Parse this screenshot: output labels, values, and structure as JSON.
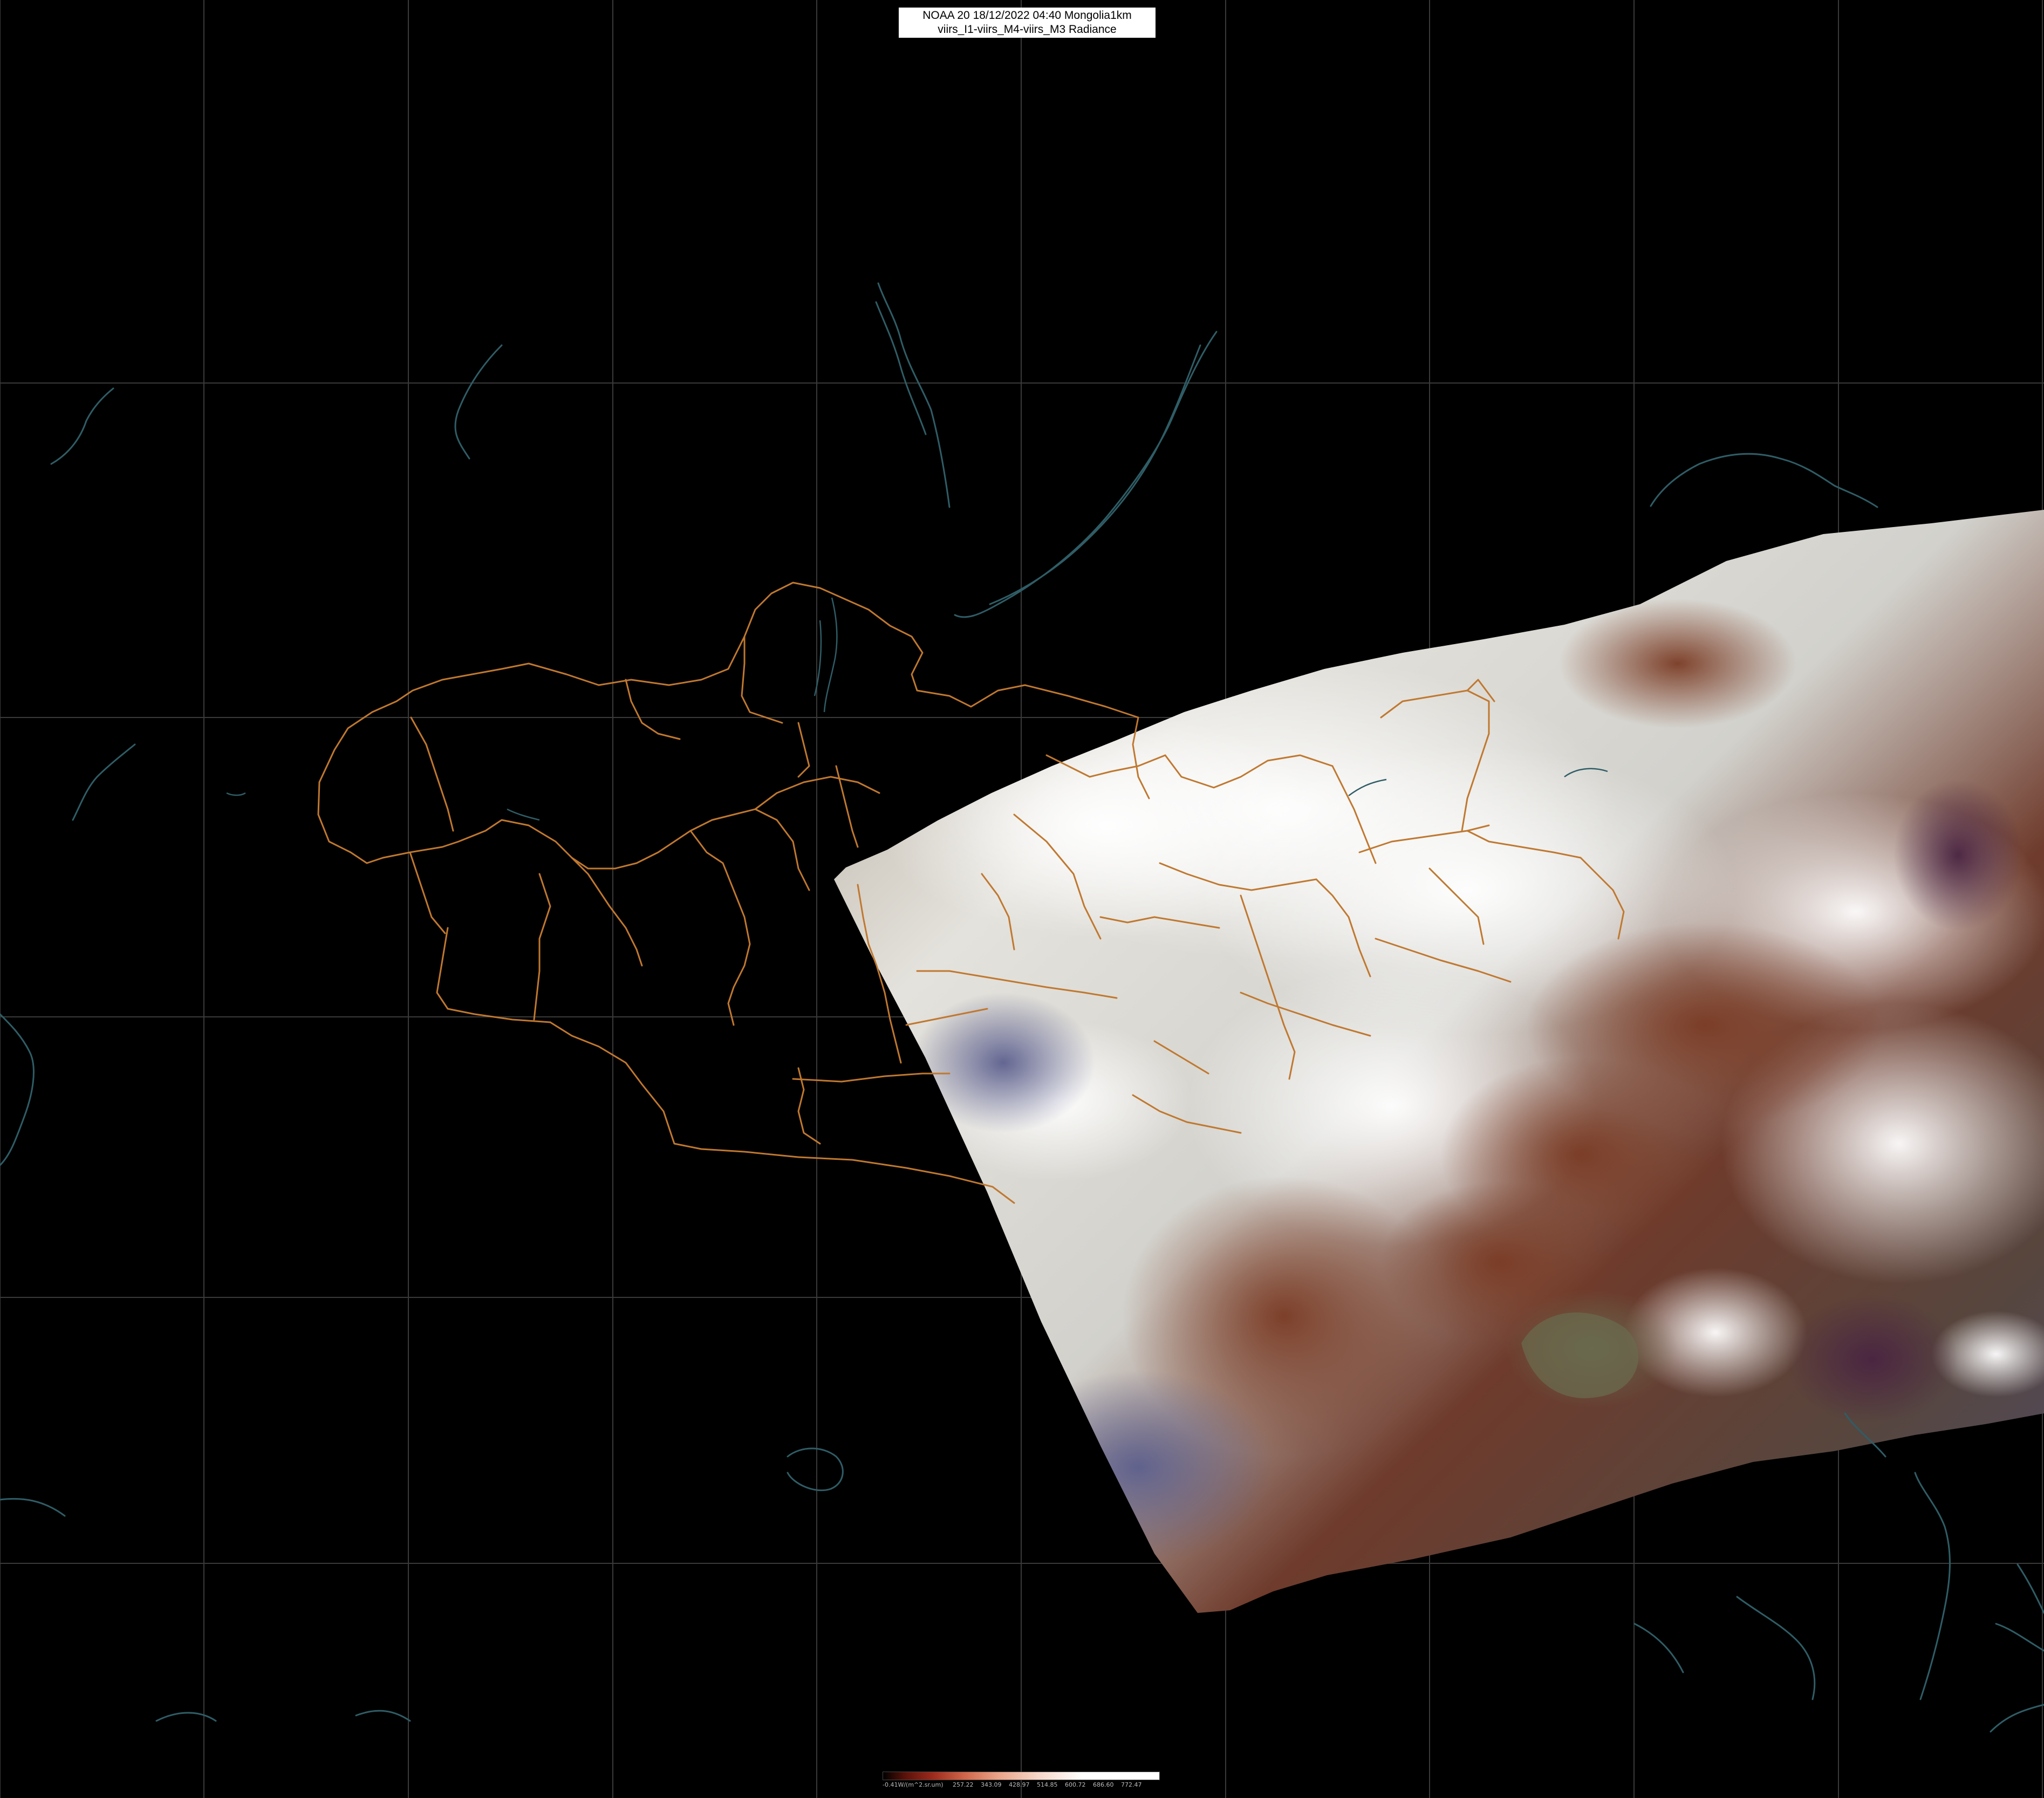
{
  "title": {
    "line1": "NOAA 20 18/12/2022 04:40 Mongolia1km",
    "line2": "viirs_I1-viirs_M4-viirs_M3 Radiance"
  },
  "colors": {
    "background": "#000000",
    "grid": "#3a3a3a",
    "borders": "#c0782f",
    "coastlines": "#2f5d66"
  },
  "legend": {
    "labels": [
      "-0.41W/(m^2.sr.um)",
      "257.22",
      "343.09",
      "428.97",
      "514.85",
      "600.72",
      "686.60",
      "772.47"
    ]
  }
}
